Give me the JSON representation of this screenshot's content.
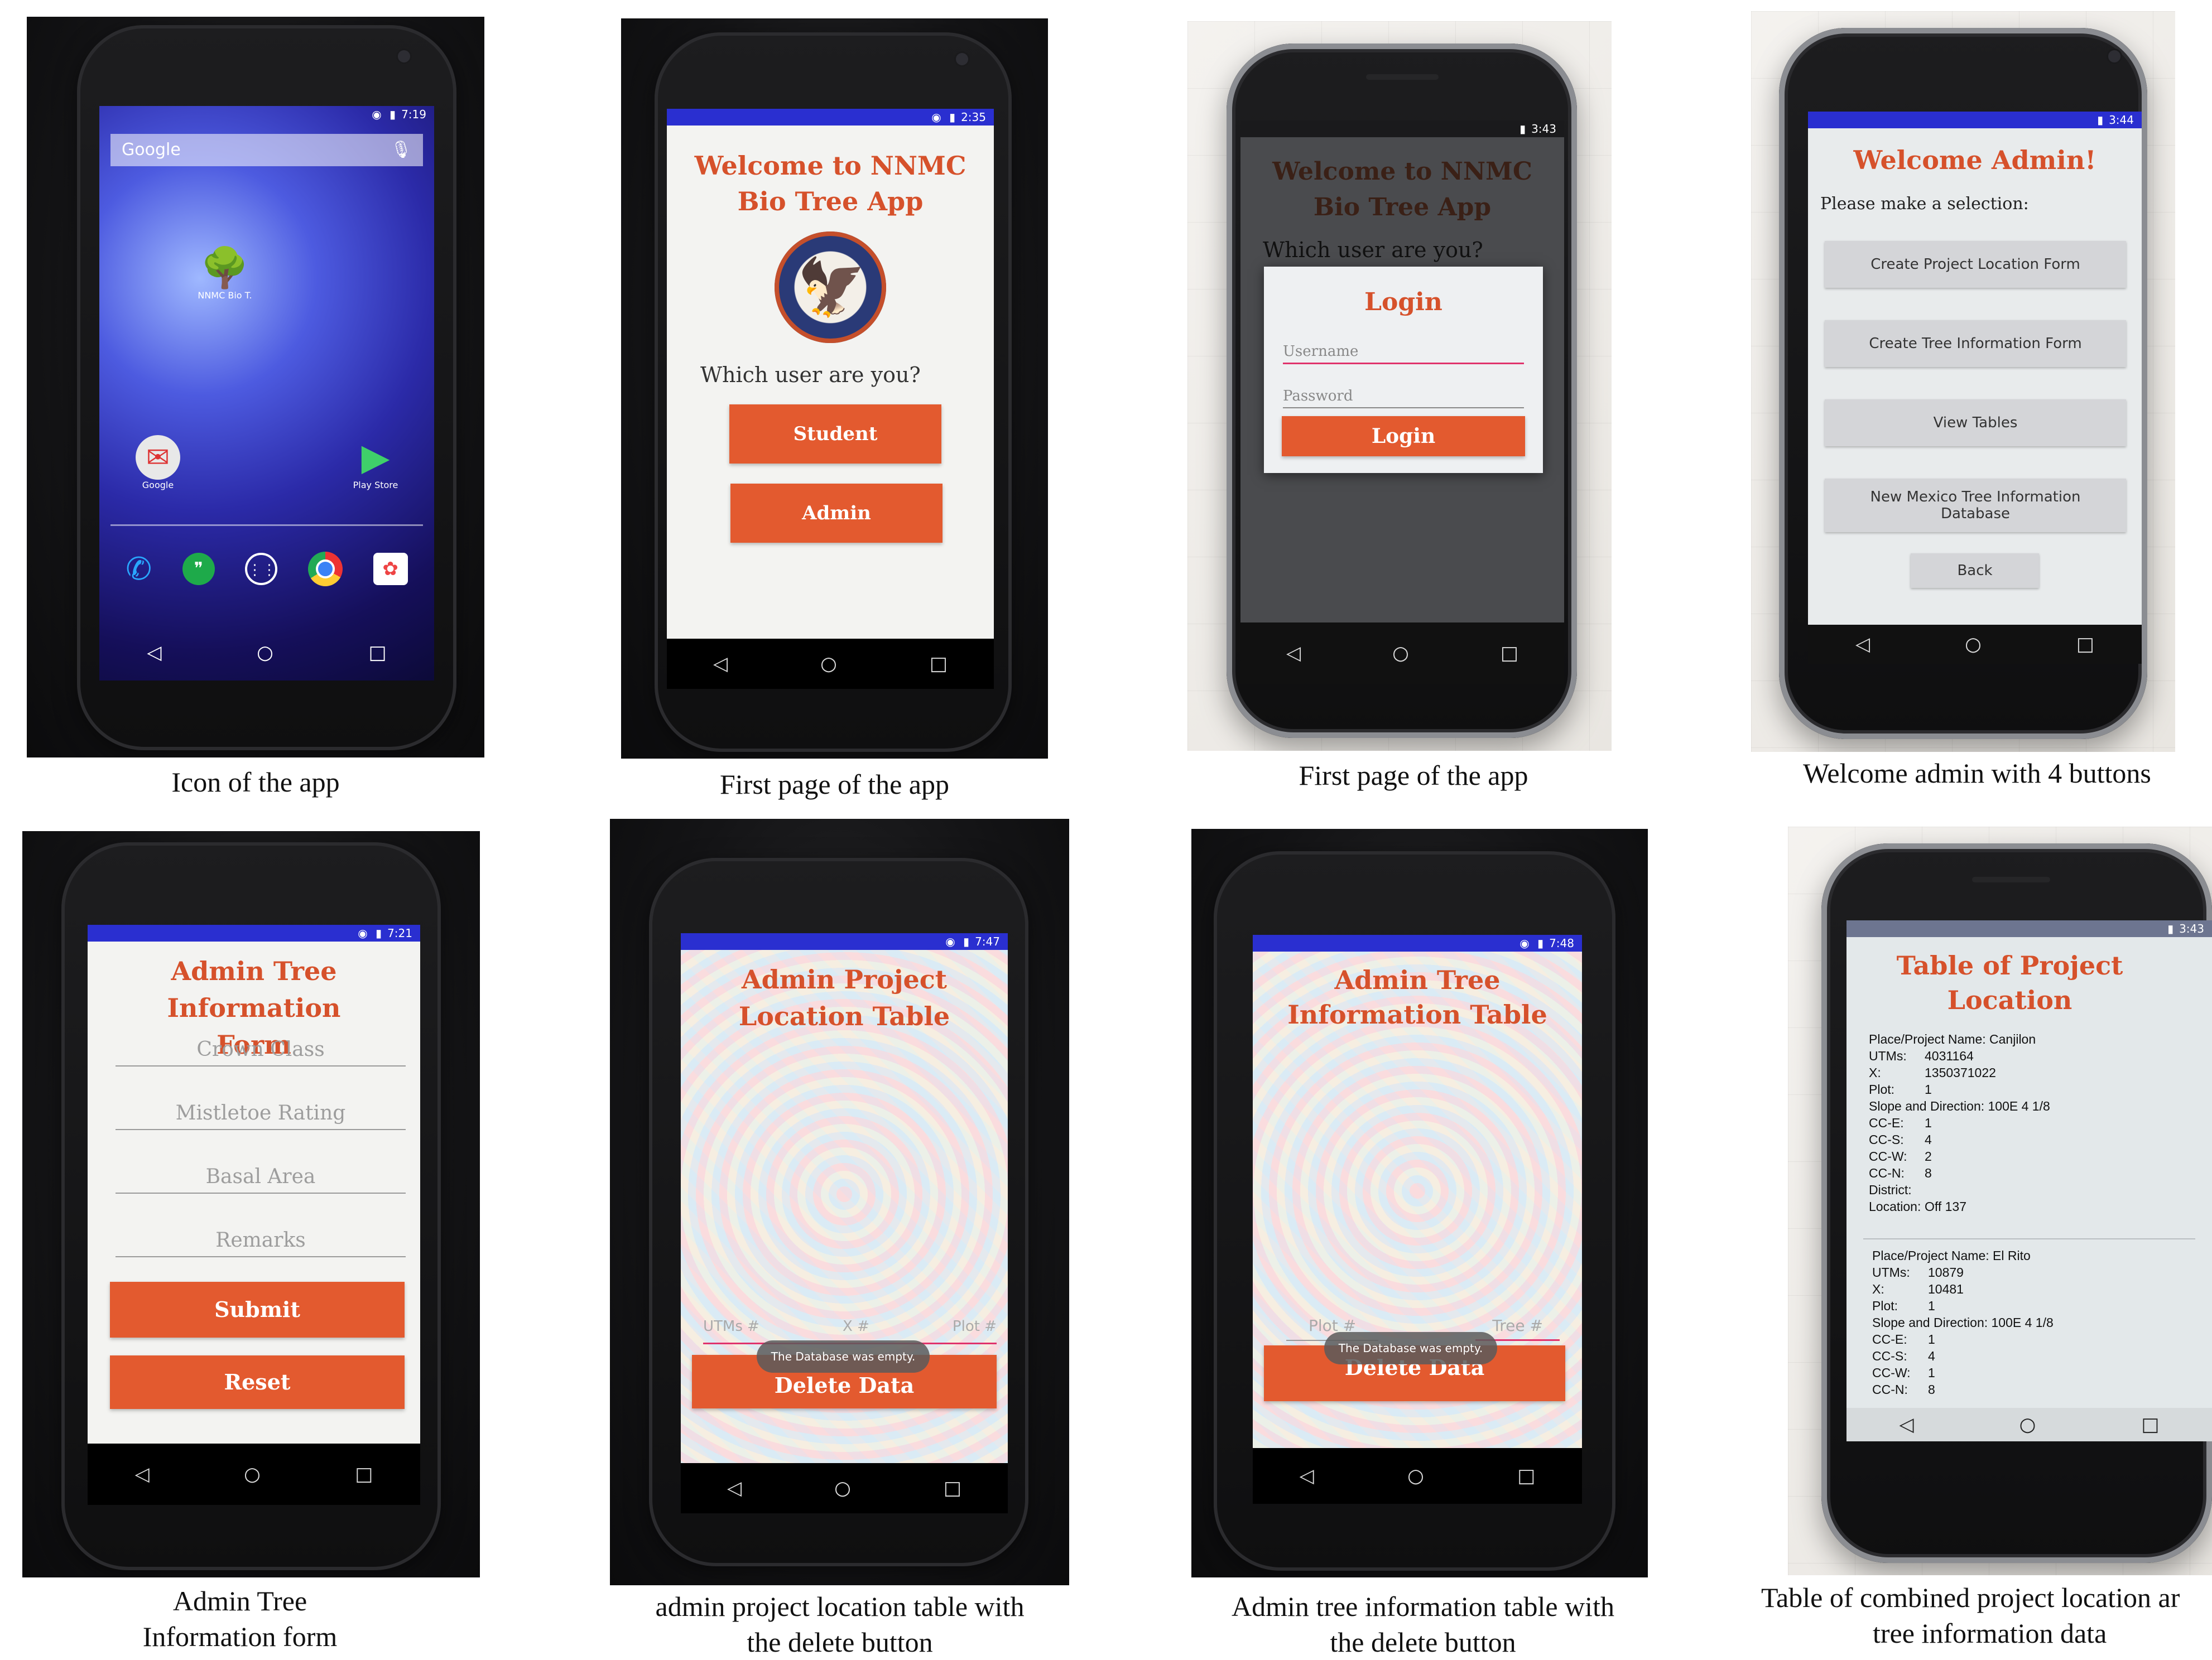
{
  "icons": {
    "nav": [
      "back-triangle",
      "home-circle",
      "recents-square"
    ],
    "status": "signal-wifi-battery"
  },
  "colors": {
    "accent": "#e35a2f",
    "title": "#d6512b",
    "statusbar": "#2a2fd0"
  },
  "panels": {
    "p1": {
      "caption": "Icon of the app",
      "time": "7:19",
      "search_label": "Google",
      "app_label": "NNMC Bio T.",
      "folder_label": "Google",
      "store_label": "Play Store"
    },
    "p2": {
      "caption": "First page of the app",
      "time": "2:35",
      "title": "Welcome to NNMC Bio Tree App",
      "prompt": "Which user are you?",
      "student_btn": "Student",
      "admin_btn": "Admin"
    },
    "p3": {
      "caption": "First page of the app",
      "time": "3:43",
      "title": "Welcome to NNMC Bio Tree App",
      "prompt": "Which user are you?",
      "dialog_title": "Login",
      "username_placeholder": "Username",
      "password_placeholder": "Password",
      "login_btn": "Login"
    },
    "p4": {
      "caption": "Welcome admin with 4 buttons",
      "time": "3:44",
      "title": "Welcome Admin!",
      "prompt": "Please make a selection:",
      "buttons": [
        "Create Project Location Form",
        "Create Tree Information Form",
        "View Tables",
        "New Mexico Tree Information Database"
      ],
      "back_btn": "Back"
    },
    "p5": {
      "caption_line1": "Admin Tree",
      "caption_line2": "Information form",
      "time": "7:21",
      "title": "Admin Tree Information Form",
      "fields": [
        "Crown Class",
        "Mistletoe Rating",
        "Basal Area",
        "Remarks"
      ],
      "submit_btn": "Submit",
      "reset_btn": "Reset"
    },
    "p6": {
      "caption_line1": "admin project location table with",
      "caption_line2": "the delete button",
      "time": "7:47",
      "title": "Admin Project Location Table",
      "col_utms": "UTMs #",
      "col_x": "X #",
      "col_plot": "Plot #",
      "toast": "The Database was empty.",
      "delete_btn": "Delete Data"
    },
    "p7": {
      "caption_line1": "Admin tree information table with",
      "caption_line2": "the delete button",
      "time": "7:48",
      "title": "Admin Tree Information Table",
      "col_plot": "Plot #",
      "col_tree": "Tree #",
      "toast": "The Database was empty.",
      "delete_btn": "Delete Data"
    },
    "p8": {
      "caption_line1": "Table of combined project location ar",
      "caption_line2": "tree information data",
      "time": "3:43",
      "title": "Table of Project Location",
      "record1": {
        "name": "Place/Project Name: Canjilon",
        "utms_k": "UTMs:",
        "utms_v": "4031164",
        "x_k": "X:",
        "x_v": "1350371022",
        "plot_k": "Plot:",
        "plot_v": "1",
        "slope": "Slope and Direction: 100E 4 1/8",
        "cce_k": "CC-E:",
        "cce_v": "1",
        "ccs_k": "CC-S:",
        "ccs_v": "4",
        "ccw_k": "CC-W:",
        "ccw_v": "2",
        "ccn_k": "CC-N:",
        "ccn_v": "8",
        "district": "District:",
        "loc_k": "Location:",
        "loc_v": "Off 137"
      },
      "record2": {
        "name": "Place/Project Name: El Rito",
        "utms_k": "UTMs:",
        "utms_v": "10879",
        "x_k": "X:",
        "x_v": "10481",
        "plot_k": "Plot:",
        "plot_v": "1",
        "slope": "Slope and Direction: 100E 4 1/8",
        "cce_k": "CC-E:",
        "cce_v": "1",
        "ccs_k": "CC-S:",
        "ccs_v": "4",
        "ccw_k": "CC-W:",
        "ccw_v": "1",
        "ccn_k": "CC-N:",
        "ccn_v": "8"
      }
    }
  }
}
